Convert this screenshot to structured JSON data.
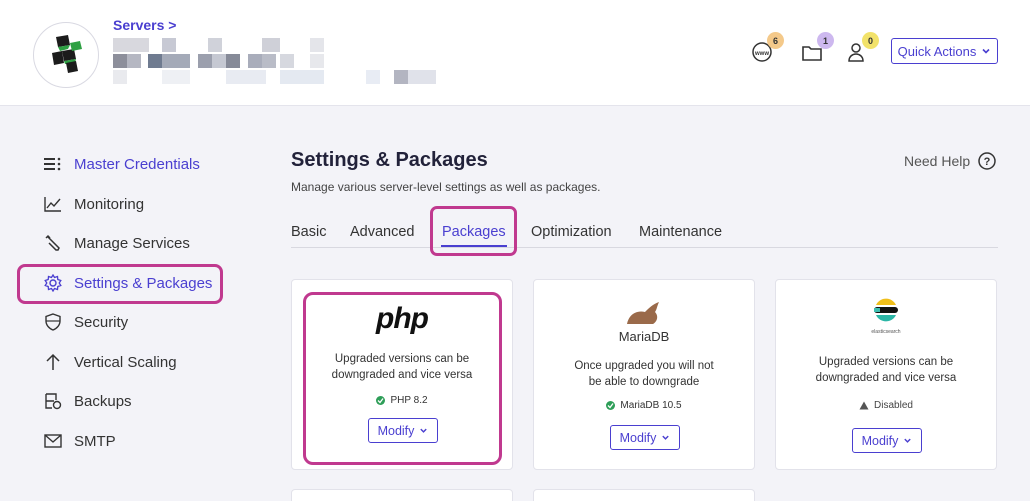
{
  "header": {
    "breadcrumb": "Servers >",
    "badges": {
      "www": "6",
      "folder": "1",
      "user": "0"
    },
    "quick_actions": "Quick Actions"
  },
  "sidebar": {
    "items": [
      {
        "label": "Master Credentials",
        "icon": "menu-list-icon"
      },
      {
        "label": "Monitoring",
        "icon": "chart-line-icon"
      },
      {
        "label": "Manage Services",
        "icon": "wrench-icon"
      },
      {
        "label": "Settings & Packages",
        "icon": "gear-icon",
        "active": true
      },
      {
        "label": "Security",
        "icon": "shield-icon"
      },
      {
        "label": "Vertical Scaling",
        "icon": "arrow-up-icon"
      },
      {
        "label": "Backups",
        "icon": "backup-icon"
      },
      {
        "label": "SMTP",
        "icon": "envelope-icon"
      }
    ]
  },
  "main": {
    "title": "Settings & Packages",
    "subtitle": "Manage various server-level settings as well as packages.",
    "help": "Need Help",
    "tabs": [
      "Basic",
      "Advanced",
      "Packages",
      "Optimization",
      "Maintenance"
    ],
    "active_tab": "Packages",
    "cards": [
      {
        "logo": "php",
        "desc1": "Upgraded versions can be",
        "desc2": "downgraded and vice versa",
        "status": "PHP 8.2",
        "button": "Modify"
      },
      {
        "logo": "MariaDB",
        "desc1": "Once upgraded you will not",
        "desc2": "be able to downgrade",
        "status": "MariaDB 10.5",
        "button": "Modify"
      },
      {
        "logo": "elasticsearch",
        "desc1": "Upgraded versions can be",
        "desc2": "downgraded and vice versa",
        "status": "Disabled",
        "button": "Modify"
      }
    ]
  },
  "colors": {
    "accent": "#4a3fd0",
    "highlight": "#c0398f",
    "ok": "#2e9e58"
  }
}
